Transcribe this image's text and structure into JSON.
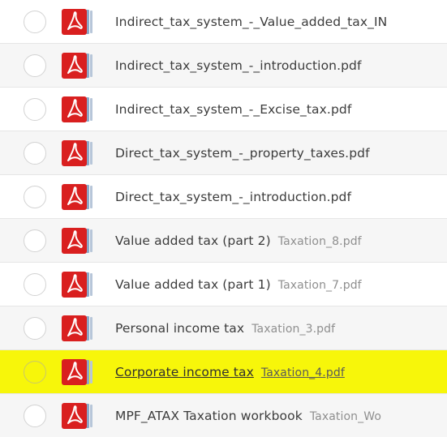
{
  "accent_color": "#1c74b8",
  "highlight_color": "#f7f60a",
  "file_icon": "pdf-icon",
  "files": [
    {
      "title": "Indirect_tax_system_-_Value_added_tax_IN",
      "filename": ""
    },
    {
      "title": "Indirect_tax_system_-_introduction.pdf",
      "filename": ""
    },
    {
      "title": "Indirect_tax_system_-_Excise_tax.pdf",
      "filename": ""
    },
    {
      "title": "Direct_tax_system_-_property_taxes.pdf",
      "filename": ""
    },
    {
      "title": "Direct_tax_system_-_introduction.pdf",
      "filename": ""
    },
    {
      "title": "Value added tax (part 2)",
      "filename": "Taxation_8.pdf"
    },
    {
      "title": "Value added tax (part 1)",
      "filename": "Taxation_7.pdf"
    },
    {
      "title": "Personal income tax",
      "filename": "Taxation_3.pdf"
    },
    {
      "title": "Corporate income tax",
      "filename": "Taxation_4.pdf"
    },
    {
      "title": "MPF_ATAX Taxation workbook",
      "filename": "Taxation_Wo"
    }
  ]
}
